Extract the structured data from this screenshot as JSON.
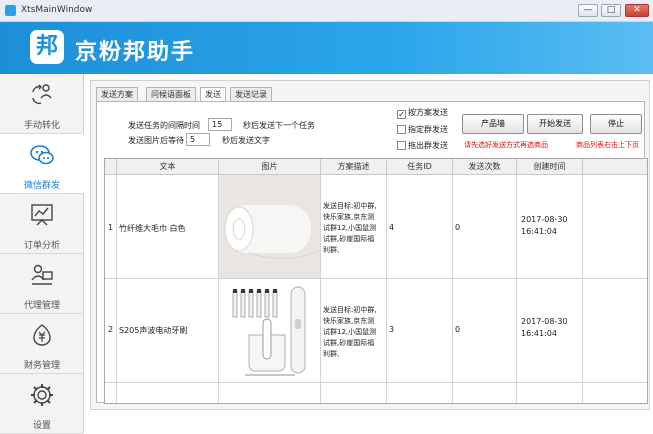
{
  "window": {
    "title": "XtsMainWindow",
    "min": "—",
    "max": "□",
    "close": "✕"
  },
  "header": {
    "logo_char": "邦",
    "brand": "京粉邦助手"
  },
  "sidebar": {
    "items": [
      {
        "label": "手动转化",
        "icon": "transform-icon",
        "active": false
      },
      {
        "label": "微信群发",
        "icon": "wechat-icon",
        "active": true
      },
      {
        "label": "订单分析",
        "icon": "chart-icon",
        "active": false
      },
      {
        "label": "代理管理",
        "icon": "agent-icon",
        "active": false
      },
      {
        "label": "财务管理",
        "icon": "finance-icon",
        "active": false
      },
      {
        "label": "设置",
        "icon": "settings-icon",
        "active": false
      }
    ]
  },
  "tabs": [
    "发送方案",
    "问候语面板",
    "发送",
    "发送记录"
  ],
  "send_settings": {
    "interval_label": "发送任务的间隔时间",
    "interval_value": "15",
    "interval_suffix": "秒后发送下一个任务",
    "image_wait_label": "发送图片后等待",
    "image_wait_value": "5",
    "image_wait_suffix": "秒后发送文字"
  },
  "options": {
    "by_plan": {
      "label": "按方案发送",
      "checked": true
    },
    "specific_group": {
      "label": "指定群发送",
      "checked": false
    },
    "pick_group": {
      "label": "拖出群发送",
      "checked": false
    }
  },
  "buttons": {
    "product_library": "产品墙",
    "start_send": "开始发送",
    "stop": "停止"
  },
  "warnings": {
    "select_method": "请先选好发送方式再选商品",
    "list_hint": "商品列表右击上下页"
  },
  "table": {
    "headers": [
      "文本",
      "图片",
      "方案描述",
      "任务ID",
      "发送次数",
      "创建时间"
    ],
    "rows": [
      {
        "index": "1",
        "text": "竹纤维大毛巾 白色",
        "image": "towel-image",
        "desc": "发送目标:初中群,快乐家族,京东测试群12,小国鼠测试群,砂崖国际福利群,",
        "task_id": "4",
        "count": "0",
        "date": "2017-08-30",
        "time": "16:41:04"
      },
      {
        "index": "2",
        "text": "S205声波电动牙刷",
        "image": "toothbrush-image",
        "desc": "发送目标:初中群,快乐家族,京东测试群12,小国鼠测试群,砂崖国际福利群,",
        "task_id": "3",
        "count": "0",
        "date": "2017-08-30",
        "time": "16:41:04"
      }
    ]
  },
  "colors": {
    "accent": "#1d8fd8",
    "warning": "#e01010",
    "active_nav": "#1a7fd0"
  }
}
